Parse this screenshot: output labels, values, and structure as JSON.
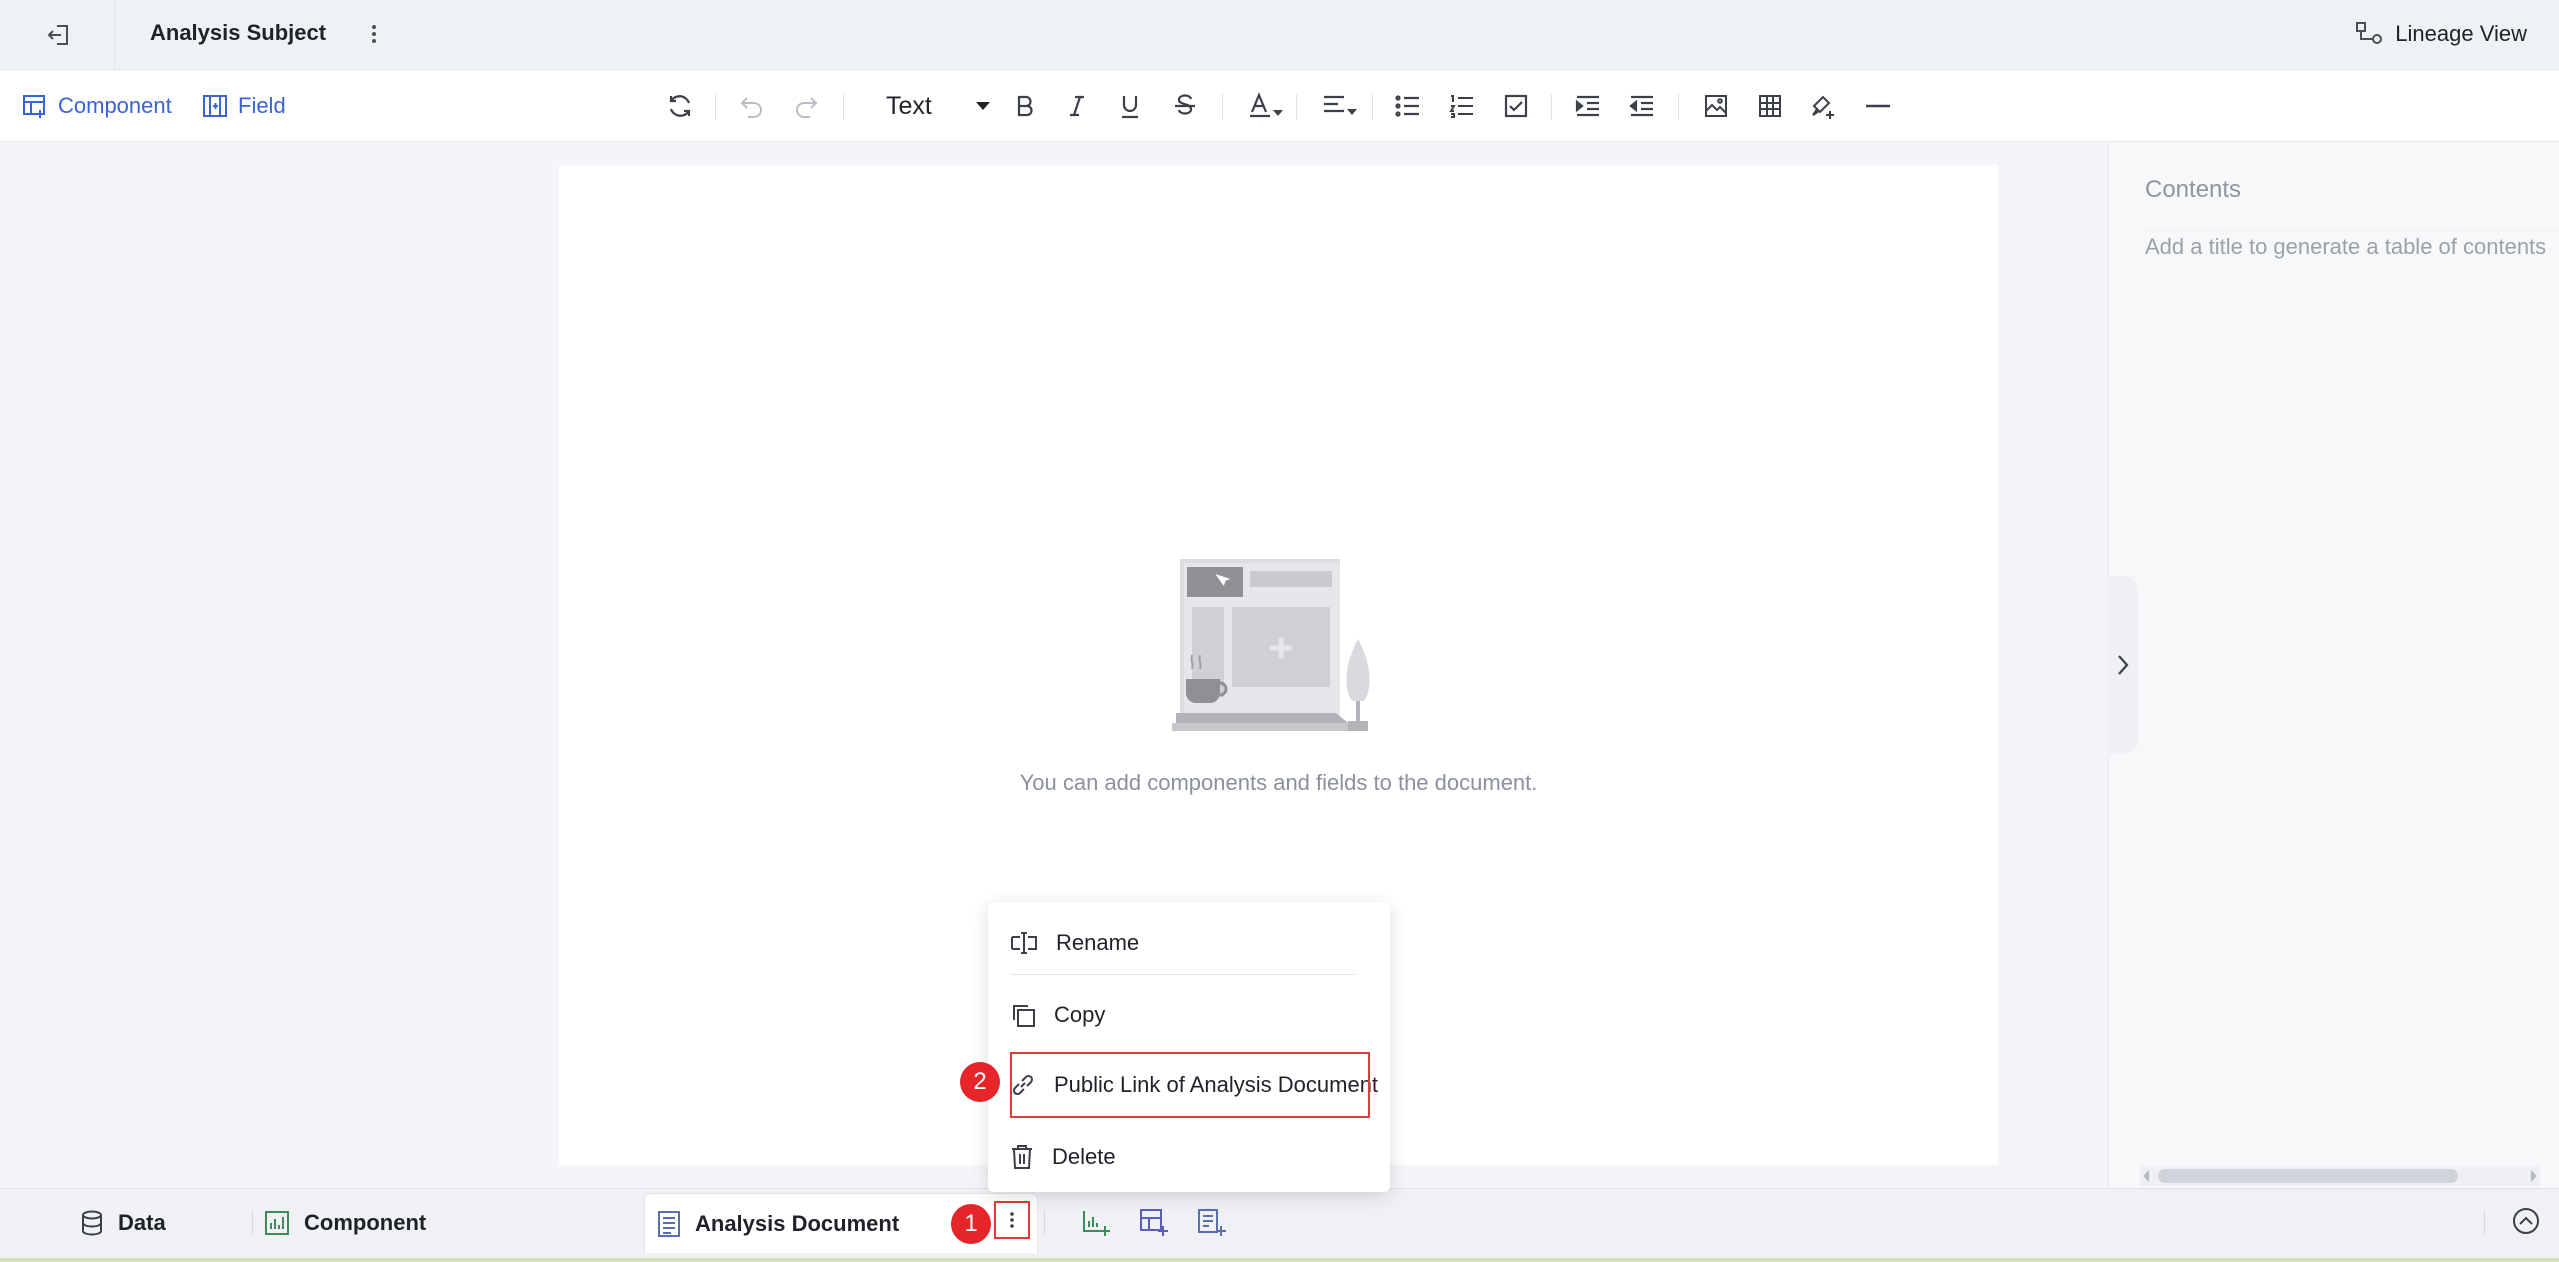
{
  "header": {
    "title": "Analysis Subject",
    "lineage_label": "Lineage View"
  },
  "toolbar": {
    "component_label": "Component",
    "field_label": "Field",
    "text_style": "Text",
    "buttons": [
      "refresh-icon",
      "undo-icon",
      "redo-icon",
      "bold-icon",
      "italic-icon",
      "underline-icon",
      "strikethrough-icon",
      "font-color-icon",
      "align-icon",
      "bullet-list-icon",
      "numbered-list-icon",
      "checklist-icon",
      "indent-icon",
      "outdent-icon",
      "image-icon",
      "table-icon",
      "format-painter-icon",
      "horizontal-rule-icon"
    ]
  },
  "canvas": {
    "empty_text": "You can add components and fields to the document."
  },
  "contents": {
    "title": "Contents",
    "hint": "Add a title to generate a table of contents"
  },
  "bottom": {
    "tabs": [
      {
        "label": "Data",
        "icon": "database-icon"
      },
      {
        "label": "Component",
        "icon": "chart-icon"
      },
      {
        "label": "Analysis Document",
        "icon": "document-icon"
      }
    ]
  },
  "menu": {
    "items": [
      {
        "label": "Rename",
        "icon": "rename-icon"
      },
      {
        "label": "Copy",
        "icon": "copy-icon"
      },
      {
        "label": "Public Link of Analysis Document",
        "icon": "link-icon"
      },
      {
        "label": "Delete",
        "icon": "trash-icon"
      }
    ]
  },
  "badges": {
    "step1": "1",
    "step2": "2"
  },
  "colors": {
    "accent": "#3a63d6",
    "highlight_red": "#e23b3b",
    "badge_red": "#e5252a"
  }
}
